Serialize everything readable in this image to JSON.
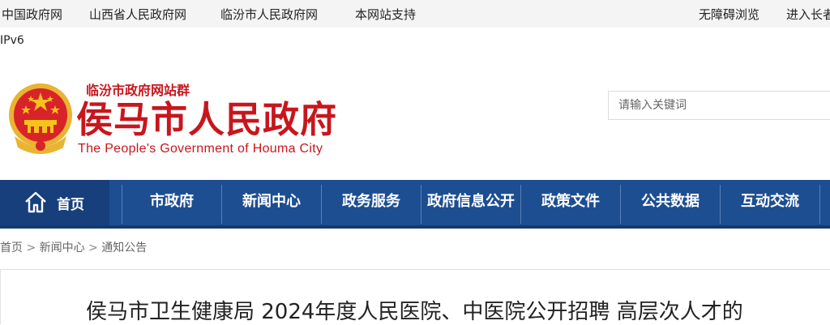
{
  "topbar": {
    "links": [
      "中国政府网",
      "山西省人民政府网",
      "临汾市人民政府网",
      "本网站支持"
    ],
    "accessibility": "无障碍浏览",
    "elder_mode": "进入长者",
    "ipv6": "IPv6"
  },
  "header": {
    "site_group": "临汾市政府网站群",
    "title": "侯马市人民政府",
    "subtitle": "The People's Government of Houma City",
    "brand_color": "#c8161d"
  },
  "search": {
    "placeholder": "请输入关键词",
    "icon": "search-icon"
  },
  "nav": {
    "home": "首页",
    "home_icon": "home-icon",
    "items": [
      "市政府",
      "新闻中心",
      "政务服务",
      "政府信息公开",
      "政策文件",
      "公共数据",
      "互动交流"
    ],
    "color": "#1d4e92"
  },
  "breadcrumb": {
    "items": [
      "首页",
      "新闻中心",
      "通知公告"
    ],
    "separator": ">"
  },
  "article": {
    "title": "侯马市卫生健康局 2024年度人民医院、中医院公开招聘 高层次人才的"
  }
}
